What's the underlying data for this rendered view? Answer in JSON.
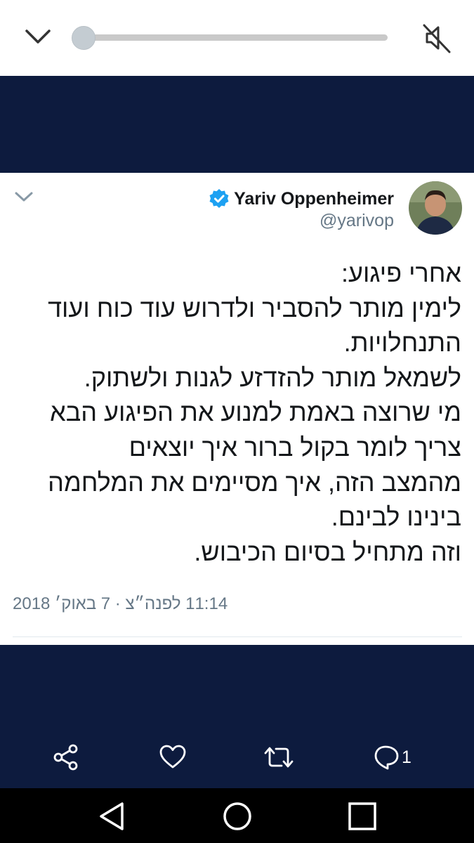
{
  "video_bar": {
    "collapse_icon": "chevron-down-icon",
    "mute_icon": "speaker-muted-icon",
    "progress": 0.0
  },
  "tweet": {
    "display_name": "Yariv Oppenheimer",
    "handle": "@yarivop",
    "verified": true,
    "text_lines": [
      "אחרי פיגוע:",
      "לימין מותר להסביר ולדרוש עוד כוח ועוד",
      "התנחלויות.",
      "לשמאל מותר להזדזע לגנות ולשתוק.",
      "מי שרוצה באמת למנוע את הפיגוע הבא",
      "צריך לומר בקול ברור איך יוצאים",
      "מהמצב הזה, איך מסיימים את המלחמה",
      "בינינו לבינם.",
      "וזה מתחיל בסיום הכיבוש."
    ],
    "timestamp": "11:14 לפנה״צ · 7 באוק׳ 2018"
  },
  "actions": {
    "share_icon": "share-icon",
    "like_icon": "heart-icon",
    "retweet_icon": "retweet-icon",
    "reply_icon": "reply-icon",
    "reply_count": "1"
  },
  "system_nav": {
    "back_icon": "back-triangle-icon",
    "home_icon": "home-circle-icon",
    "recents_icon": "recents-square-icon"
  },
  "colors": {
    "navy_background": "#0d1b3e",
    "verified_blue": "#1da1f2",
    "secondary_text": "#657786"
  }
}
